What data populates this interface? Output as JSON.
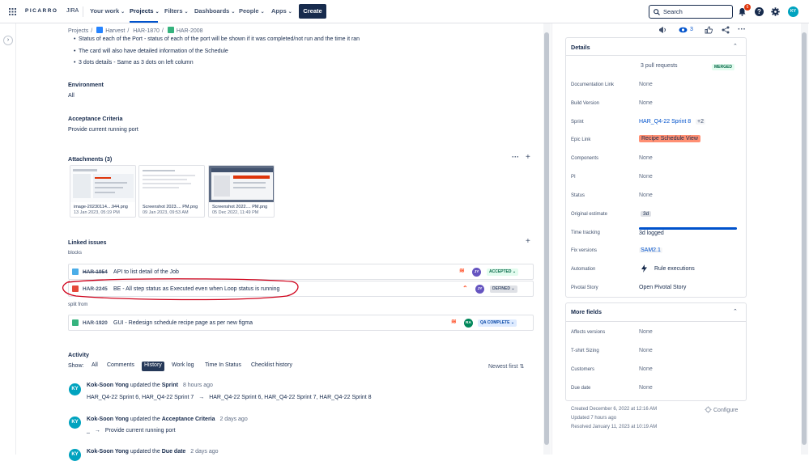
{
  "topbar": {
    "logo": "PICARRO",
    "product": "JIRA",
    "nav": [
      "Your work",
      "Projects",
      "Filters",
      "Dashboards",
      "People",
      "Apps"
    ],
    "create_label": "Create",
    "search_placeholder": "Search",
    "notification_count": "6",
    "user_initials": "KY"
  },
  "breadcrumb": {
    "root": "Projects",
    "project": "Harvest",
    "parent": "HAR-1870",
    "issue": "HAR-2008"
  },
  "description": {
    "bullets": [
      "Status of each of the Port - status of each of the port will be shown if it was completed/not run and the time it ran",
      "The card will also have detailed information of the Schedule",
      "3 dots details - Same as 3 dots on left column"
    ]
  },
  "environment": {
    "label": "Environment",
    "value": "All"
  },
  "acceptance": {
    "label": "Acceptance Criteria",
    "value": "Provide current running port"
  },
  "attachments": {
    "title": "Attachments (3)",
    "items": [
      {
        "name": "image-20230114....944.png",
        "date": "13 Jan 2023, 05:19 PM"
      },
      {
        "name": "Screenshot 2023.... PM.png",
        "date": "09 Jan 2023, 09:53 AM"
      },
      {
        "name": "Screenshot 2022.... PM.png",
        "date": "05 Dec 2022, 11:49 PM"
      }
    ]
  },
  "linked": {
    "title": "Linked issues",
    "group1": "blocks",
    "group2": "split from",
    "rows": [
      {
        "key": "HAR-1954",
        "summary": "API to list detail of the Job",
        "assignee": "JY",
        "status": "ACCEPTED"
      },
      {
        "key": "HAR-2245",
        "summary": "BE - All step status as Executed even when Loop status is running",
        "assignee": "JY",
        "status": "DEFINED"
      },
      {
        "key": "HAR-1920",
        "summary": "GUI - Redesign schedule recipe page as per new figma",
        "assignee": "RA",
        "status": "QA COMPLETE"
      }
    ]
  },
  "activity": {
    "title": "Activity",
    "show_label": "Show:",
    "tabs": [
      "All",
      "Comments",
      "History",
      "Work log",
      "Time In Status",
      "Checklist history"
    ],
    "sort_label": "Newest first",
    "entries": [
      {
        "initials": "KY",
        "user": "Kok-Soon Yong",
        "verb": "updated the",
        "field": "Sprint",
        "time": "8 hours ago",
        "from": "HAR_Q4-22 Sprint 6, HAR_Q4-22 Sprint 7",
        "arrow": "→",
        "to": "HAR_Q4-22 Sprint 6, HAR_Q4-22 Sprint 7, HAR_Q4-22 Sprint 8"
      },
      {
        "initials": "KY",
        "user": "Kok-Soon Yong",
        "verb": "updated the",
        "field": "Acceptance Criteria",
        "time": "2 days ago",
        "from": "_",
        "arrow": "→",
        "to": "Provide current running port"
      },
      {
        "initials": "KY",
        "user": "Kok-Soon Yong",
        "verb": "updated the",
        "field": "Due date",
        "time": "2 days ago"
      }
    ]
  },
  "toolbar": {
    "watch_count": "3"
  },
  "details": {
    "title": "Details",
    "pull_requests": "3 pull requests",
    "merged": "MERGED",
    "fields": [
      {
        "label": "Documentation Link",
        "value": "None"
      },
      {
        "label": "Build Version",
        "value": "None"
      },
      {
        "label": "Sprint",
        "value": "HAR_Q4-22 Sprint 8",
        "extra": "+2"
      },
      {
        "label": "Epic Link",
        "value": "Recipe Schedule View"
      },
      {
        "label": "Components",
        "value": "None"
      },
      {
        "label": "PI",
        "value": "None"
      },
      {
        "label": "Status",
        "value": "None"
      },
      {
        "label": "Original estimate",
        "value": "3d"
      },
      {
        "label": "Time tracking",
        "value": "3d logged"
      },
      {
        "label": "Fix versions",
        "value": "SAM2.1"
      },
      {
        "label": "Automation",
        "value": "Rule executions"
      },
      {
        "label": "Pivotal Story",
        "value": "Open Pivotal Story"
      }
    ]
  },
  "more_fields": {
    "title": "More fields",
    "fields": [
      {
        "label": "Affects versions",
        "value": "None"
      },
      {
        "label": "T-shirt Sizing",
        "value": "None"
      },
      {
        "label": "Customers",
        "value": "None"
      },
      {
        "label": "Due date",
        "value": "None"
      }
    ]
  },
  "meta": {
    "created": "Created December 6, 2022 at 12:16 AM",
    "updated": "Updated 7 hours ago",
    "resolved": "Resolved January 11, 2023 at 10:19 AM",
    "configure": "Configure"
  },
  "colors": {
    "accent": "#0052cc",
    "dark": "#172b4d",
    "annotation": "#d0021b",
    "epic": "#ff8f73"
  }
}
